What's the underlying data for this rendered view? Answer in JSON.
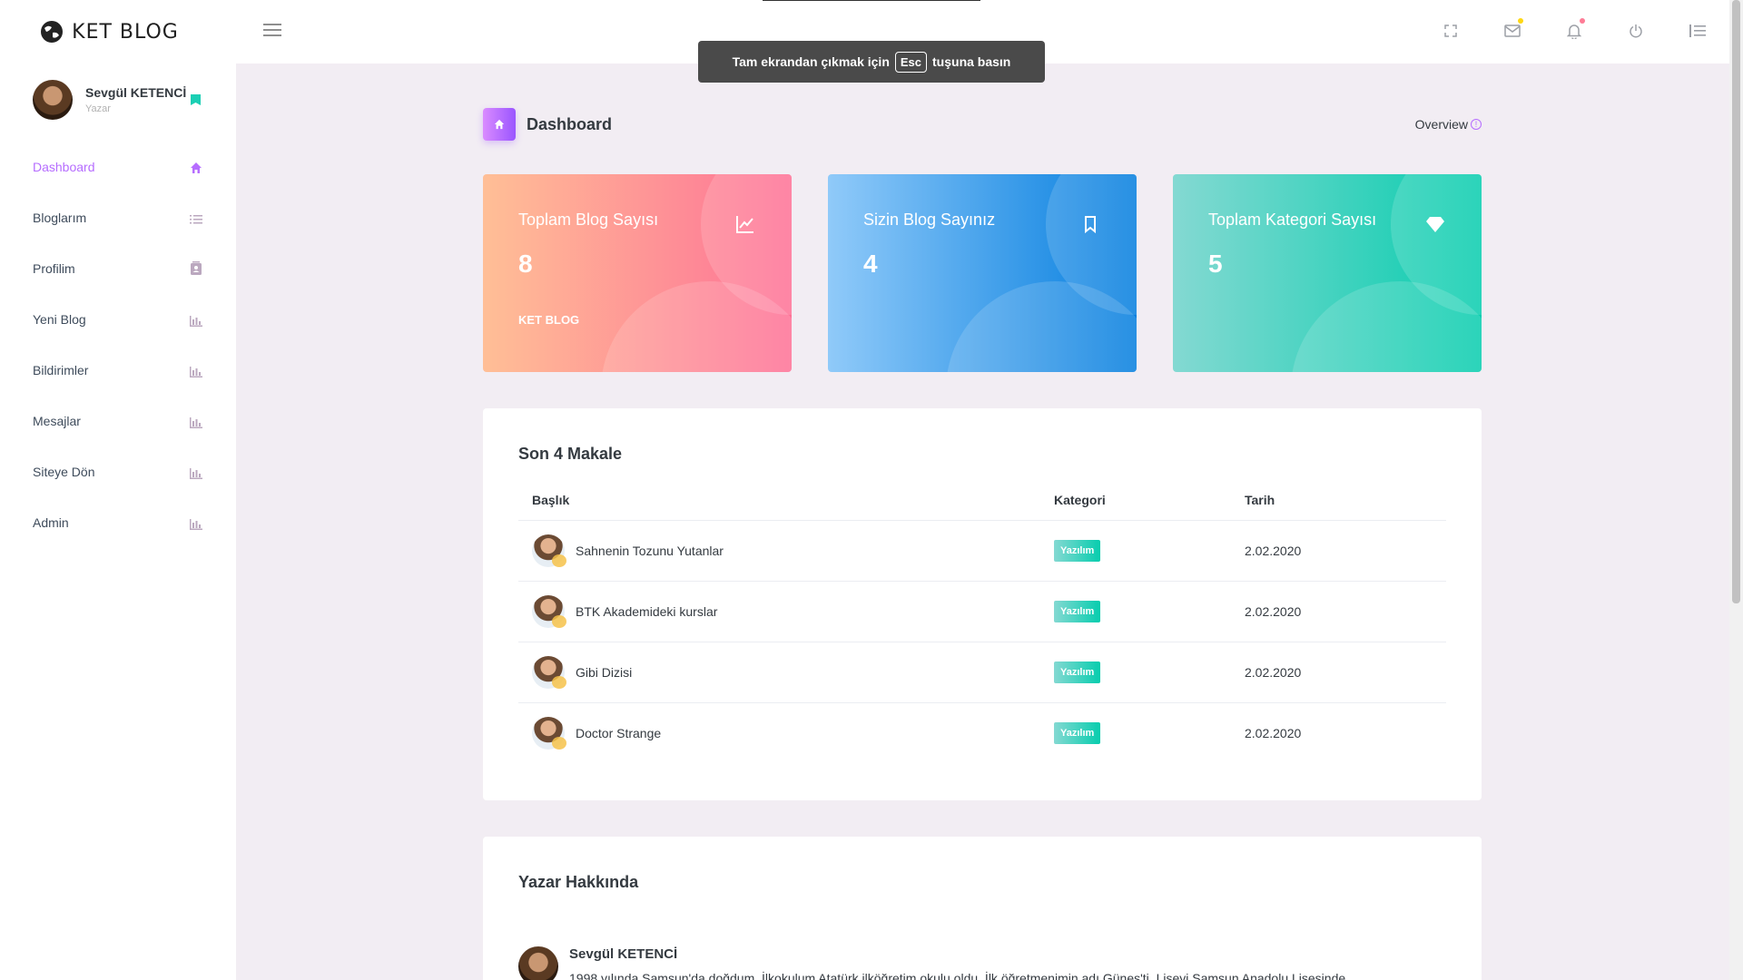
{
  "brand": {
    "name": "KET BLOG"
  },
  "user": {
    "name": "Sevgül KETENCİ",
    "role": "Yazar"
  },
  "nav": [
    {
      "label": "Dashboard",
      "icon": "home-icon",
      "active": true
    },
    {
      "label": "Bloglarım",
      "icon": "list-icon"
    },
    {
      "label": "Profilim",
      "icon": "contacts-icon"
    },
    {
      "label": "Yeni Blog",
      "icon": "chart-bar-icon"
    },
    {
      "label": "Bildirimler",
      "icon": "chart-bar-icon"
    },
    {
      "label": "Mesajlar",
      "icon": "chart-bar-icon"
    },
    {
      "label": "Siteye Dön",
      "icon": "chart-bar-icon"
    },
    {
      "label": "Admin",
      "icon": "chart-bar-icon"
    }
  ],
  "toast": {
    "before": "Tam ekrandan çıkmak için",
    "key": "Esc",
    "after": "tuşuna basın"
  },
  "header": {
    "title": "Dashboard",
    "overview": "Overview"
  },
  "cards": [
    {
      "title": "Toplam Blog Sayısı",
      "value": "8",
      "footer": "KET BLOG",
      "icon": "chart-line-icon",
      "color": "#fe7096"
    },
    {
      "title": "Sizin Blog Sayınız",
      "value": "4",
      "footer": "",
      "icon": "bookmark-icon",
      "color": "#047edf"
    },
    {
      "title": "Toplam Kategori Sayısı",
      "value": "5",
      "footer": "",
      "icon": "diamond-icon",
      "color": "#07cdae"
    }
  ],
  "recent": {
    "title": "Son 4 Makale",
    "columns": [
      "Başlık",
      "Kategori",
      "Tarih"
    ],
    "rows": [
      {
        "title": "Sahnenin Tozunu Yutanlar",
        "category": "Yazılım",
        "date": "2.02.2020"
      },
      {
        "title": "BTK Akademideki kurslar",
        "category": "Yazılım",
        "date": "2.02.2020"
      },
      {
        "title": "Gibi Dizisi",
        "category": "Yazılım",
        "date": "2.02.2020"
      },
      {
        "title": "Doctor Strange",
        "category": "Yazılım",
        "date": "2.02.2020"
      }
    ]
  },
  "about": {
    "title": "Yazar Hakkında",
    "name": "Sevgül KETENCİ",
    "bio": "1998 yılında Samsun'da doğdum. İlkokulum Atatürk ilköğretim okulu oldu. İlk öğretmenimin adı Güneş'ti. Liseyi Samsun Anadolu Lisesinde"
  },
  "colors": {
    "accent": "#b66dff",
    "background": "#f2edf3"
  }
}
